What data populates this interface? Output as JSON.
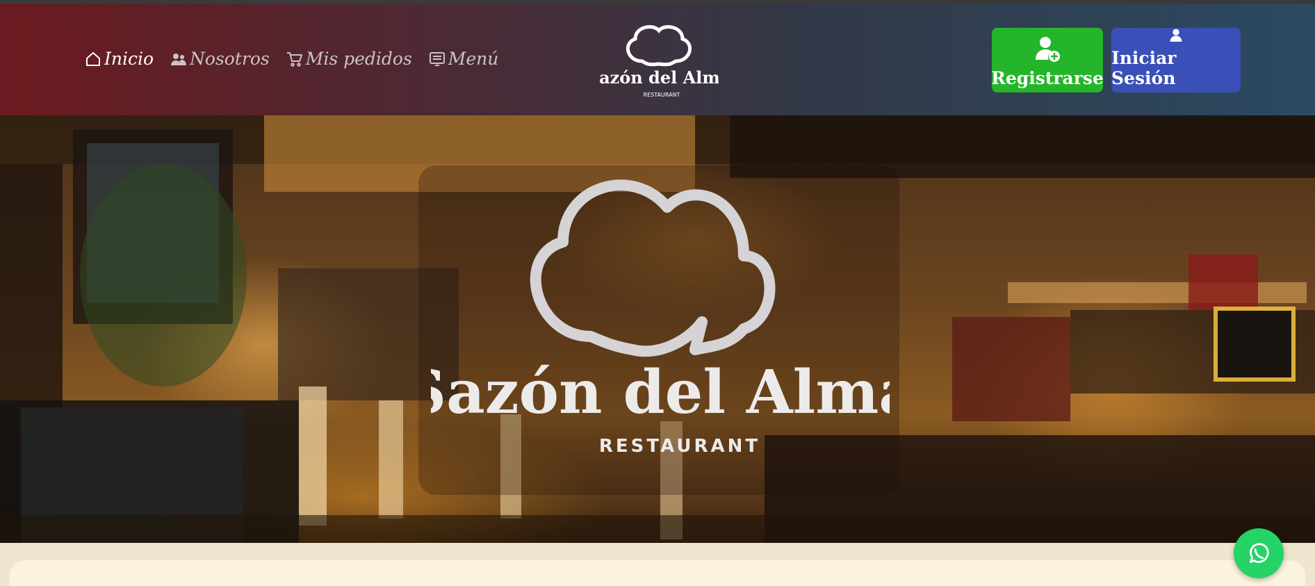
{
  "nav": {
    "items": [
      {
        "label": "Inicio",
        "icon": "home-icon",
        "active": true
      },
      {
        "label": "Nosotros",
        "icon": "users-icon",
        "active": false
      },
      {
        "label": "Mis pedidos",
        "icon": "cart-icon",
        "active": false
      },
      {
        "label": "Menú",
        "icon": "menu-list-icon",
        "active": false
      }
    ]
  },
  "brand": {
    "name": "Sazón del Alma",
    "tagline": "RESTAURANT"
  },
  "actions": {
    "register_label": "Registrarse",
    "login_label": "Iniciar Sesión"
  },
  "hero": {
    "logo_name": "Sazón del Alma",
    "logo_tagline": "RESTAURANT"
  },
  "floating": {
    "whatsapp_icon": "whatsapp-icon"
  },
  "colors": {
    "register_button": "#25b52a",
    "login_button": "#3b4fb8",
    "whatsapp": "#25d366"
  }
}
